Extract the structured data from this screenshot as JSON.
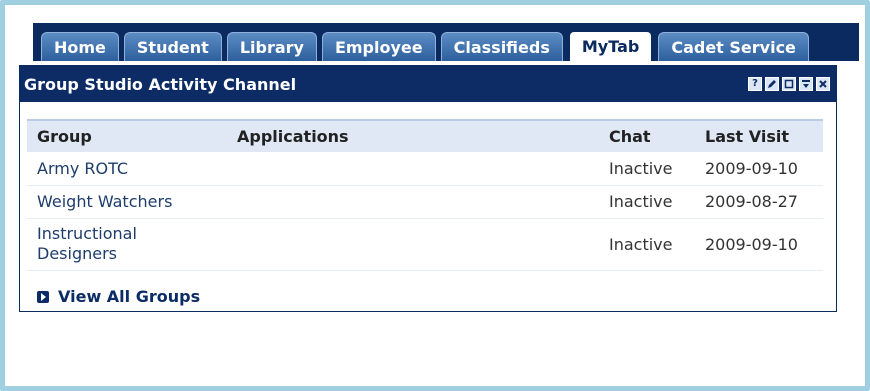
{
  "tabs": [
    {
      "label": "Home"
    },
    {
      "label": "Student"
    },
    {
      "label": "Library"
    },
    {
      "label": "Employee"
    },
    {
      "label": "Classifieds"
    },
    {
      "label": "MyTab"
    },
    {
      "label": "Cadet Service"
    }
  ],
  "active_tab": "MyTab",
  "portlet": {
    "title": "Group Studio Activity Channel",
    "controls": [
      "help-icon",
      "edit-icon",
      "maximize-icon",
      "minimize-icon",
      "close-icon"
    ]
  },
  "table": {
    "headers": [
      "Group",
      "Applications",
      "Chat",
      "Last Visit"
    ],
    "rows": [
      {
        "group": "Army ROTC",
        "applications": "",
        "chat": "Inactive",
        "last_visit": "2009-09-10"
      },
      {
        "group": "Weight Watchers",
        "applications": "",
        "chat": "Inactive",
        "last_visit": "2009-08-27"
      },
      {
        "group": "Instructional Designers",
        "applications": "",
        "chat": "Inactive",
        "last_visit": "2009-09-10"
      }
    ]
  },
  "view_all": "View All Groups",
  "colors": {
    "nav": "#0b2b60",
    "header": "#0d2c66",
    "frame": "#9fcfe0"
  }
}
